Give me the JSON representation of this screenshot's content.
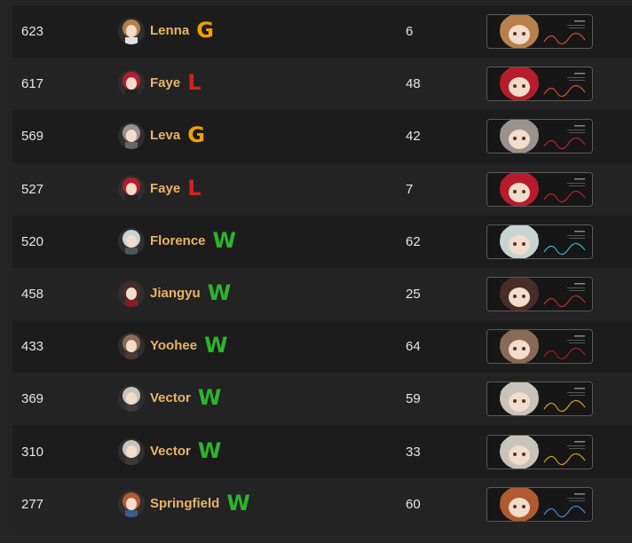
{
  "colors": {
    "name": "#eab36a",
    "G": "#f0a000",
    "L": "#d42020",
    "W": "#2db42d"
  },
  "rows": [
    {
      "score": "623",
      "name": "Lenna",
      "result": "G",
      "count": "6",
      "icon": "lenna-avatar-icon",
      "banner": "lenna-banner-icon",
      "hair": "#b7804a",
      "accent": "#e0e0e0",
      "sig": "#d05030"
    },
    {
      "score": "617",
      "name": "Faye",
      "result": "L",
      "count": "48",
      "icon": "faye-avatar-icon",
      "banner": "lenna-banner-icon",
      "hair": "#b71c2c",
      "accent": "#222222",
      "sig": "#d05030"
    },
    {
      "score": "569",
      "name": "Leva",
      "result": "G",
      "count": "42",
      "icon": "leva-avatar-icon",
      "banner": "leva-banner-icon",
      "hair": "#9a928c",
      "accent": "#6a6360",
      "sig": "#c02030"
    },
    {
      "score": "527",
      "name": "Faye",
      "result": "L",
      "count": "7",
      "icon": "faye-avatar-icon",
      "banner": "leva-banner-icon",
      "hair": "#b71c2c",
      "accent": "#222222",
      "sig": "#c02030"
    },
    {
      "score": "520",
      "name": "Florence",
      "result": "W",
      "count": "62",
      "icon": "florence-avatar-icon",
      "banner": "florence-banner-icon",
      "hair": "#c8d4d4",
      "accent": "#4a5a5a",
      "sig": "#30b8c8"
    },
    {
      "score": "458",
      "name": "Jiangyu",
      "result": "W",
      "count": "25",
      "icon": "jiangyu-avatar-icon",
      "banner": "jiangyu-banner-icon",
      "hair": "#4a2c26",
      "accent": "#8a1c24",
      "sig": "#c03030"
    },
    {
      "score": "433",
      "name": "Yoohee",
      "result": "W",
      "count": "64",
      "icon": "yoohee-avatar-icon",
      "banner": "yoohee-banner-icon",
      "hair": "#8a6a56",
      "accent": "#4a3a30",
      "sig": "#a02020"
    },
    {
      "score": "369",
      "name": "Vector",
      "result": "W",
      "count": "59",
      "icon": "vector-avatar-icon",
      "banner": "vector-banner-icon",
      "hair": "#c8c4bc",
      "accent": "#3a3a3a",
      "sig": "#d0a020"
    },
    {
      "score": "310",
      "name": "Vector",
      "result": "W",
      "count": "33",
      "icon": "vector-avatar-icon",
      "banner": "vector-banner-icon",
      "hair": "#c8c4bc",
      "accent": "#3a3a3a",
      "sig": "#d0a020"
    },
    {
      "score": "277",
      "name": "Springfield",
      "result": "W",
      "count": "60",
      "icon": "springfield-avatar-icon",
      "banner": "springfield-banner-icon",
      "hair": "#b05a32",
      "accent": "#3a5a8a",
      "sig": "#4a8ad0"
    }
  ]
}
